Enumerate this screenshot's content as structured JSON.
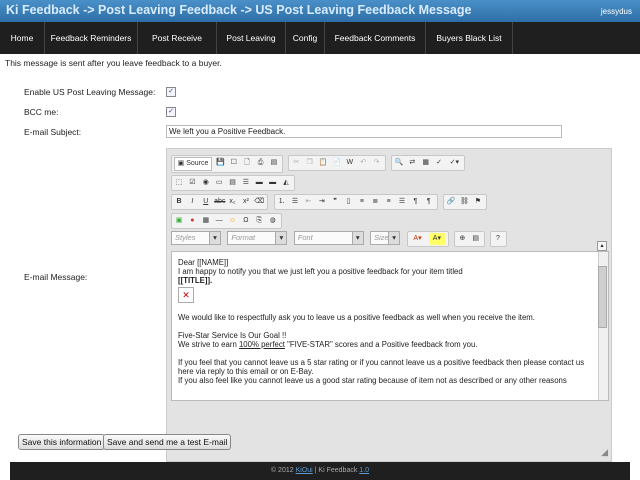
{
  "header": {
    "title": "Ki Feedback -> Post Leaving Feedback -> US Post Leaving Feedback Message",
    "user": "jessydus"
  },
  "nav": {
    "items": [
      "Home",
      "Feedback Reminders",
      "Post Receive",
      "Post Leaving",
      "Config",
      "Feedback Comments",
      "Buyers Black List"
    ]
  },
  "intro": "This message is sent after you leave feedback to a buyer.",
  "form": {
    "enable_label": "Enable US Post Leaving Message:",
    "enable_checked": true,
    "bcc_label": "BCC me:",
    "bcc_checked": true,
    "subject_label": "E-mail Subject:",
    "subject_value": "We left you a Positive Feedback.",
    "message_label": "E-mail Message:"
  },
  "editor": {
    "source_label": "Source",
    "styles": "Styles",
    "format": "Format",
    "font": "Font",
    "size": "Size",
    "body": {
      "greeting": "Dear [[NAME]]",
      "line1": "I am happy to notify you that we just left you a positive feedback for your item titled",
      "line2": "[[TITLE]].",
      "para1": "We would like to respectfully ask you to leave us a positive feedback as well when you receive the item.",
      "para2a": "Five-Star Service Is Our Goal !!",
      "para2b_pre": "We strive to earn ",
      "para2b_link": "100% perfect",
      "para2b_post": " \"FIVE-STAR\" scores and a Positive feedback from you.",
      "para3a": "If you feel that you cannot leave us a 5 star rating or if you cannot leave us a positive feedback then please contact us",
      "para3b": "here via reply to this email or on E-Bay.",
      "para4": "If you also feel like you cannot leave us a good star rating because of item not as described or any other reasons"
    }
  },
  "buttons": {
    "save": "Save this information",
    "save_test": "Save and send me a test E-mail"
  },
  "footer": {
    "copyright": "© 2012",
    "brand_link": "KiOui",
    "sep": " | Ki Feedback ",
    "version": "1.0"
  }
}
